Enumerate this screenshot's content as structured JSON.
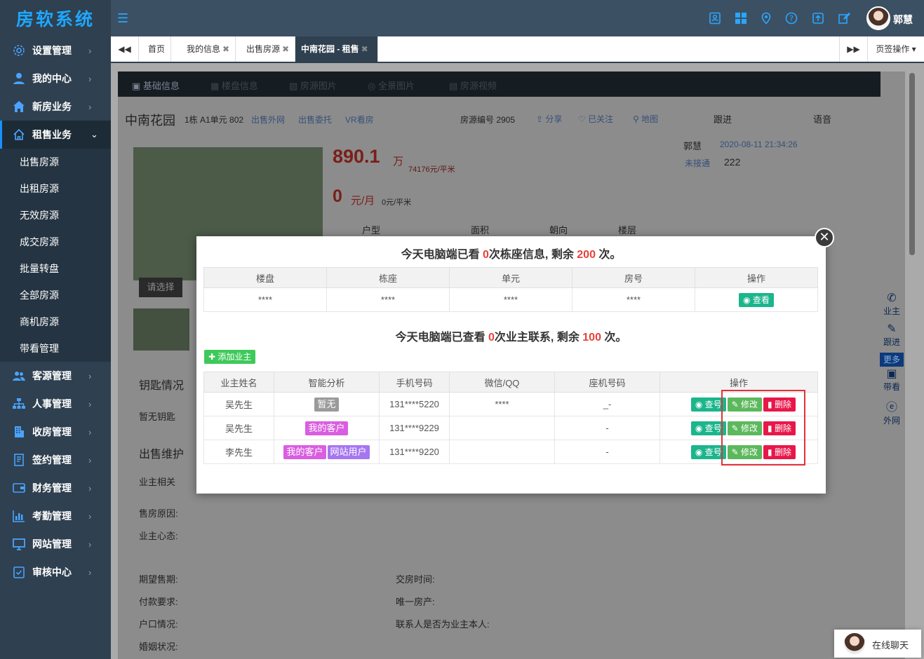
{
  "app": {
    "logo": "房软系统",
    "user": "郭慧"
  },
  "sidebar": {
    "items": [
      {
        "label": "设置管理",
        "icon": "gear-icon"
      },
      {
        "label": "我的中心",
        "icon": "user-icon"
      },
      {
        "label": "新房业务",
        "icon": "home-icon"
      },
      {
        "label": "租售业务",
        "icon": "house-outline-icon"
      }
    ],
    "sub": [
      "出售房源",
      "出租房源",
      "无效房源",
      "成交房源",
      "批量转盘",
      "全部房源",
      "商机房源",
      "带看管理"
    ],
    "items2": [
      {
        "label": "客源管理",
        "icon": "users-icon"
      },
      {
        "label": "人事管理",
        "icon": "org-icon"
      },
      {
        "label": "收房管理",
        "icon": "building-icon"
      },
      {
        "label": "签约管理",
        "icon": "contract-icon"
      },
      {
        "label": "财务管理",
        "icon": "wallet-icon"
      },
      {
        "label": "考勤管理",
        "icon": "bar-chart-icon"
      },
      {
        "label": "网站管理",
        "icon": "monitor-icon"
      },
      {
        "label": "审核中心",
        "icon": "check-icon"
      }
    ]
  },
  "tabs": {
    "home": "首页",
    "t1": "我的信息",
    "t2": "出售房源",
    "t3": "中南花园 - 租售",
    "ops": "页签操作"
  },
  "bg": {
    "ptab1": "基础信息",
    "ptab2": "楼盘信息",
    "ptab3": "房源图片",
    "ptab4": "全景图片",
    "ptab5": "房源视频",
    "name": "中南花园",
    "addr": "1栋 A1单元 802",
    "lk1": "出售外网",
    "lk2": "出售委托",
    "lk3": "VR看房",
    "code": "房源编号 2905",
    "share": "分享",
    "follow": "已关注",
    "map": "地图",
    "price": "890.1",
    "wan": "万",
    "unit": "74176元/平米",
    "rent": "0",
    "rentunit": "元/月",
    "rentunit2": "0元/平米",
    "h1": "户型",
    "h2": "面积",
    "h3": "朝向",
    "h4": "楼层",
    "choose": "请选择",
    "key": "钥匙情况",
    "nokey": "暂无钥匙",
    "maint": "出售维护",
    "owner": "业主相关",
    "f1": "售房原因:",
    "f2": "业主心态:",
    "f3": "期望售期:",
    "f4": "付款要求:",
    "f5": "户口情况:",
    "f6": "婚姻状况:",
    "g1": "交房时间:",
    "g2": "唯一房产:",
    "g3": "联系人是否为业主本人:",
    "follow_tab": "跟进",
    "voice_tab": "语音",
    "fu_user": "郭慧",
    "fu_time": "2020-08-11 21:34:26",
    "fu_status": "未接通",
    "fu_text": "222"
  },
  "rightbar": [
    "业主",
    "跟进",
    "更多",
    "带看",
    "外网"
  ],
  "modal": {
    "t1_pre": "今天电脑端已看 ",
    "t1_n1": "0",
    "t1_mid": "次栋座信息, 剩余 ",
    "t1_n2": "200",
    "t1_post": " 次。",
    "t2_pre": "今天电脑端已查看 ",
    "t2_n1": "0",
    "t2_mid": "次业主联系, 剩余 ",
    "t2_n2": "100",
    "t2_post": " 次。",
    "table1": {
      "headers": [
        "楼盘",
        "栋座",
        "单元",
        "房号",
        "操作"
      ],
      "row": [
        "****",
        "****",
        "****",
        "****"
      ],
      "btn": "查看"
    },
    "add": "添加业主",
    "table2": {
      "headers": [
        "业主姓名",
        "智能分析",
        "手机号码",
        "微信/QQ",
        "座机号码",
        "操作"
      ],
      "rows": [
        {
          "name": "吴先生",
          "tags": [
            "暂无"
          ],
          "phone": "131****5220",
          "wx": "****",
          "tel": "_-"
        },
        {
          "name": "吴先生",
          "tags": [
            "我的客户"
          ],
          "phone": "131****9229",
          "wx": "",
          "tel": "-"
        },
        {
          "name": "李先生",
          "tags": [
            "我的客户",
            "网站用户"
          ],
          "phone": "131****9220",
          "wx": "",
          "tel": "-"
        }
      ],
      "view": "查号",
      "edit": "修改",
      "del": "删除"
    }
  },
  "chat": "在线聊天"
}
